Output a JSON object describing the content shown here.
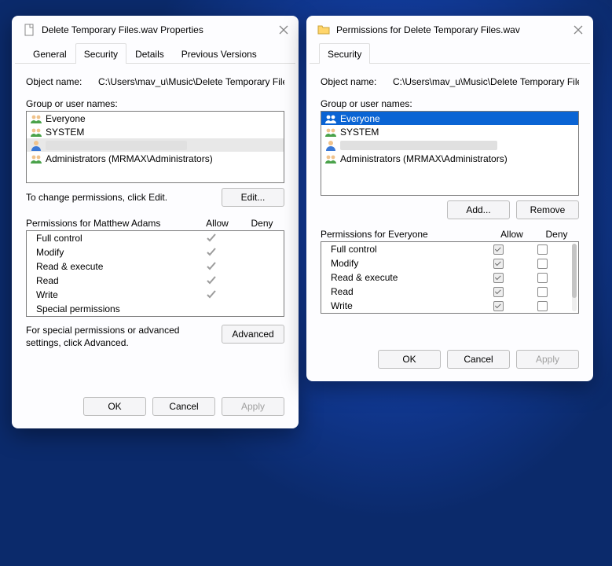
{
  "left": {
    "title": "Delete Temporary Files.wav Properties",
    "tabs": [
      "General",
      "Security",
      "Details",
      "Previous Versions"
    ],
    "activeTab": 1,
    "objectLabel": "Object name:",
    "objectValue": "C:\\Users\\mav_u\\Music\\Delete Temporary Files.wa",
    "groupLabel": "Group or user names:",
    "users": [
      {
        "name": "Everyone",
        "icon": "group",
        "sel": ""
      },
      {
        "name": "SYSTEM",
        "icon": "group",
        "sel": ""
      },
      {
        "name": "",
        "icon": "user",
        "sel": "masked sel"
      },
      {
        "name": "Administrators (MRMAX\\Administrators)",
        "icon": "group",
        "sel": ""
      }
    ],
    "editHint": "To change permissions, click Edit.",
    "editBtn": "Edit...",
    "permHeader": "Permissions for Matthew Adams",
    "colAllow": "Allow",
    "colDeny": "Deny",
    "perms": [
      {
        "name": "Full control",
        "allow": true,
        "deny": false
      },
      {
        "name": "Modify",
        "allow": true,
        "deny": false
      },
      {
        "name": "Read & execute",
        "allow": true,
        "deny": false
      },
      {
        "name": "Read",
        "allow": true,
        "deny": false
      },
      {
        "name": "Write",
        "allow": true,
        "deny": false
      },
      {
        "name": "Special permissions",
        "allow": false,
        "deny": false
      }
    ],
    "advText": "For special permissions or advanced settings, click Advanced.",
    "advBtn": "Advanced",
    "ok": "OK",
    "cancel": "Cancel",
    "apply": "Apply"
  },
  "right": {
    "title": "Permissions for Delete Temporary Files.wav",
    "tabs": [
      "Security"
    ],
    "activeTab": 0,
    "objectLabel": "Object name:",
    "objectValue": "C:\\Users\\mav_u\\Music\\Delete Temporary Files.wa",
    "groupLabel": "Group or user names:",
    "users": [
      {
        "name": "Everyone",
        "icon": "group",
        "sel": "selBlue"
      },
      {
        "name": "SYSTEM",
        "icon": "group",
        "sel": ""
      },
      {
        "name": "",
        "icon": "user",
        "sel": "masked"
      },
      {
        "name": "Administrators (MRMAX\\Administrators)",
        "icon": "group",
        "sel": ""
      }
    ],
    "addBtn": "Add...",
    "removeBtn": "Remove",
    "permHeader": "Permissions for Everyone",
    "colAllow": "Allow",
    "colDeny": "Deny",
    "perms": [
      {
        "name": "Full control",
        "allow": true,
        "deny": false
      },
      {
        "name": "Modify",
        "allow": true,
        "deny": false
      },
      {
        "name": "Read & execute",
        "allow": true,
        "deny": false
      },
      {
        "name": "Read",
        "allow": true,
        "deny": false
      },
      {
        "name": "Write",
        "allow": true,
        "deny": false
      }
    ],
    "ok": "OK",
    "cancel": "Cancel",
    "apply": "Apply"
  }
}
